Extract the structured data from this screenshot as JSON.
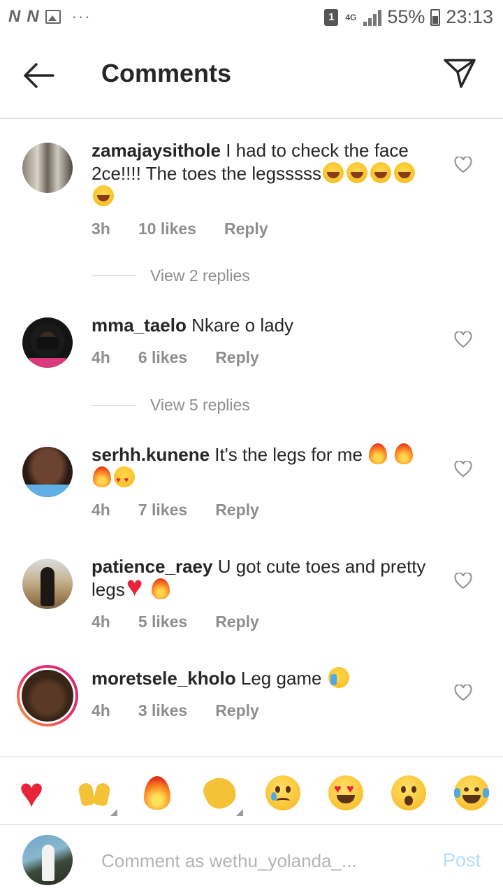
{
  "status_bar": {
    "left_icons": [
      "N",
      "N"
    ],
    "image_icon": "image-icon",
    "more": "···",
    "sim": "1",
    "network": "4G",
    "signal_icon": "signal-icon",
    "battery_percent": "55%",
    "time": "23:13"
  },
  "header": {
    "title": "Comments",
    "back_icon": "arrow-left-icon",
    "send_icon": "paper-plane-icon"
  },
  "comments": [
    {
      "username": "zamajaysithole",
      "text": "I had to check the face 2ce!!!! The toes the legsssss",
      "emojis": [
        "laughing-tears",
        "laughing-tears",
        "laughing-tears",
        "laughing-tears",
        "laughing-tears"
      ],
      "time": "3h",
      "likes": "10 likes",
      "reply": "Reply",
      "view_replies": "View 2 replies"
    },
    {
      "username": "mma_taelo",
      "text": "Nkare o lady",
      "time": "4h",
      "likes": "6 likes",
      "reply": "Reply",
      "view_replies": "View 5 replies"
    },
    {
      "username": "serhh.kunene",
      "text": "It's the legs for me",
      "emojis": [
        "fire",
        "fire",
        "fire",
        "heart-eyes"
      ],
      "time": "4h",
      "likes": "7 likes",
      "reply": "Reply"
    },
    {
      "username": "patience_raey",
      "text": "U got cute toes and pretty legs",
      "emojis": [
        "red-heart",
        "fire"
      ],
      "time": "4h",
      "likes": "5 likes",
      "reply": "Reply"
    },
    {
      "username": "moretsele_kholo",
      "text": "Leg game",
      "emojis": [
        "loudly-crying"
      ],
      "time": "4h",
      "likes": "3 likes",
      "reply": "Reply",
      "has_story_ring": true
    }
  ],
  "emoji_bar": [
    "red-heart",
    "raising-hands",
    "fire",
    "clapping-hands",
    "crying-face",
    "heart-eyes",
    "surprised-face",
    "laughing-tears"
  ],
  "composer": {
    "placeholder": "Comment as wethu_yolanda_...",
    "post_label": "Post"
  }
}
